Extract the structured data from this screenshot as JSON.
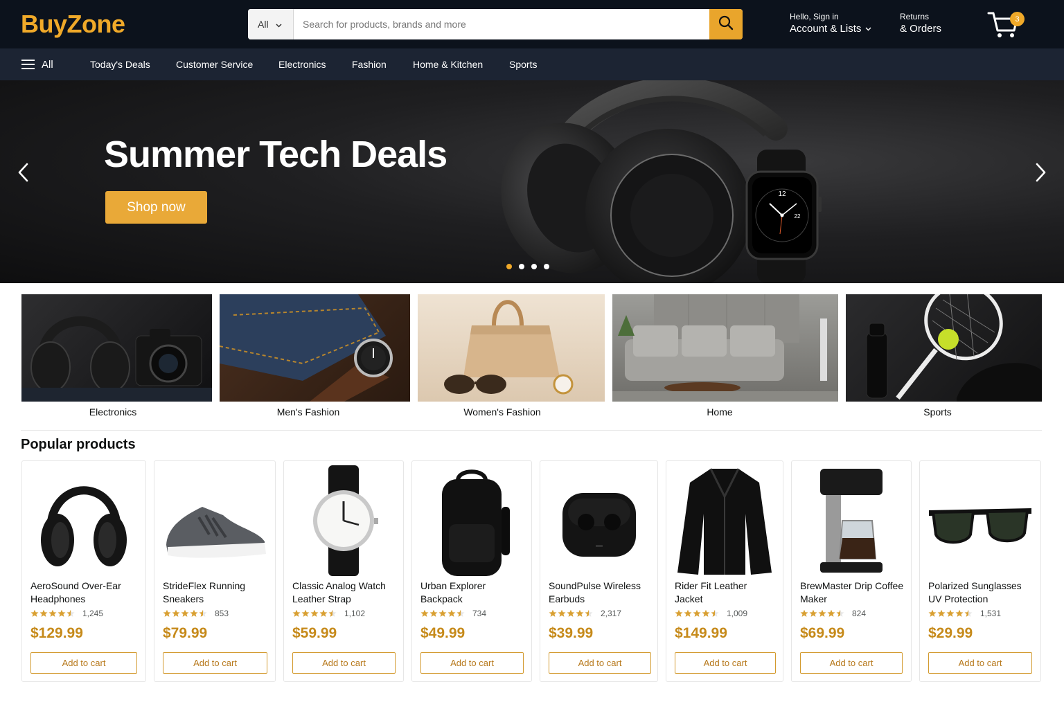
{
  "header": {
    "logo": "BuyZone",
    "search": {
      "category": "All",
      "placeholder": "Search for products, brands and more"
    },
    "account": {
      "greeting": "Hello, Sign in",
      "label": "Account & Lists"
    },
    "returns": {
      "line1": "Returns",
      "line2": "& Orders"
    },
    "cart": {
      "count": "3"
    }
  },
  "nav": {
    "all_label": "All",
    "items": [
      "Today's Deals",
      "Customer Service",
      "Electronics",
      "Fashion",
      "Home & Kitchen",
      "Sports"
    ]
  },
  "hero": {
    "title": "Summer Tech Deals",
    "button": "Shop now",
    "slides": 4,
    "active_slide": 1,
    "watch_number": "22",
    "watch_twelve": "12"
  },
  "categories": [
    {
      "label": "Electronics"
    },
    {
      "label": "Men's Fashion"
    },
    {
      "label": "Women's Fashion"
    },
    {
      "label": "Home"
    },
    {
      "label": "Sports"
    }
  ],
  "popular": {
    "title": "Popular products",
    "button_label": "Add to cart",
    "products": [
      {
        "name": "AeroSound Over-Ear Headphones",
        "rating": 4.5,
        "reviews": "1,245",
        "price": "$129.99"
      },
      {
        "name": "StrideFlex Running Sneakers",
        "rating": 4.5,
        "reviews": "853",
        "price": "$79.99"
      },
      {
        "name": "Classic Analog Watch Leather Strap",
        "rating": 4.5,
        "reviews": "1,102",
        "price": "$59.99"
      },
      {
        "name": "Urban Explorer Backpack",
        "rating": 4.5,
        "reviews": "734",
        "price": "$49.99"
      },
      {
        "name": "SoundPulse Wireless Earbuds",
        "rating": 4.5,
        "reviews": "2,317",
        "price": "$39.99"
      },
      {
        "name": "Rider Fit Leather Jacket",
        "rating": 4.5,
        "reviews": "1,009",
        "price": "$149.99"
      },
      {
        "name": "BrewMaster Drip Coffee Maker",
        "rating": 4.5,
        "reviews": "824",
        "price": "$69.99"
      },
      {
        "name": "Polarized Sunglasses UV Protection",
        "rating": 4.5,
        "reviews": "1,531",
        "price": "$29.99"
      }
    ]
  },
  "colors": {
    "header_bg": "#0c121c",
    "nav_bg": "#1c2433",
    "accent": "#f0a929",
    "price": "#c68a1a"
  }
}
